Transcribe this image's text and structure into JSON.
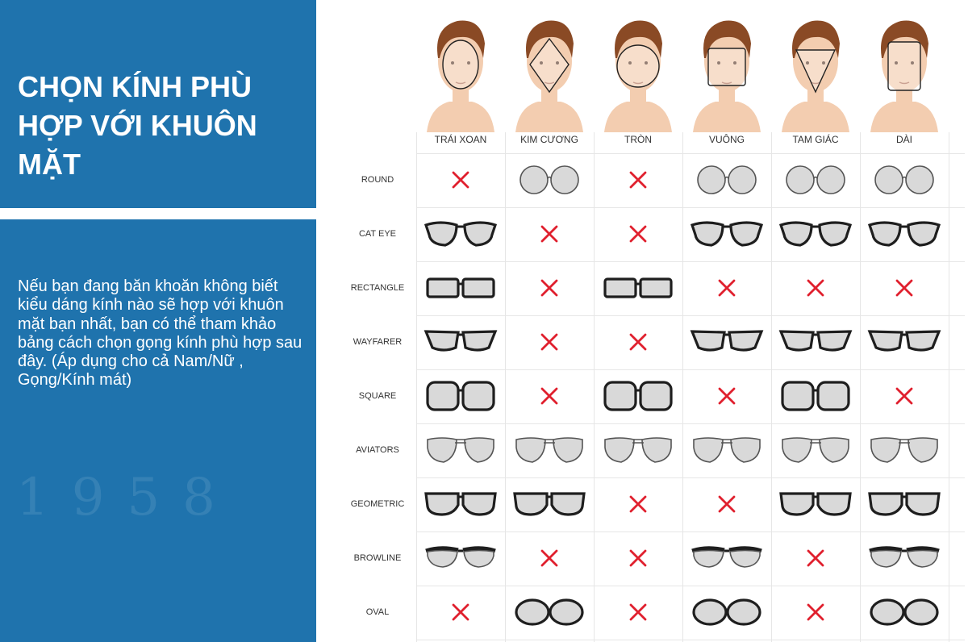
{
  "left_panel": {
    "title": "CHỌN KÍNH PHÙ HỢP VỚI KHUÔN MẶT",
    "description": "Nếu bạn đang băn khoăn không biết kiểu dáng kính nào sẽ hợp với khuôn mặt bạn nhất, bạn có thể tham khảo bảng cách chọn gọng kính phù hợp sau đây. (Áp dụng cho cả Nam/Nữ , Gọng/Kính mát)",
    "watermark": "1958",
    "background_color": "#1f73ad"
  },
  "table": {
    "columns": [
      "TRÁI XOAN",
      "KIM CƯƠNG",
      "TRÒN",
      "VUÔNG",
      "TAM GIÁC",
      "DÀI"
    ],
    "face_outlines": [
      "oval-outline",
      "diamond-outline",
      "circle-outline",
      "square-outline",
      "triangle-outline",
      "oblong-outline"
    ],
    "rows": [
      {
        "label": "ROUND",
        "shape": "round",
        "fits": [
          false,
          true,
          false,
          true,
          true,
          true
        ]
      },
      {
        "label": "CAT EYE",
        "shape": "cateye",
        "fits": [
          true,
          false,
          false,
          true,
          true,
          true
        ]
      },
      {
        "label": "RECTANGLE",
        "shape": "rectangle",
        "fits": [
          true,
          false,
          true,
          false,
          false,
          false
        ]
      },
      {
        "label": "WAYFARER",
        "shape": "wayfarer",
        "fits": [
          true,
          false,
          false,
          true,
          true,
          true
        ]
      },
      {
        "label": "SQUARE",
        "shape": "square",
        "fits": [
          true,
          false,
          true,
          false,
          true,
          false
        ]
      },
      {
        "label": "AVIATORS",
        "shape": "aviator",
        "fits": [
          true,
          true,
          true,
          true,
          true,
          true
        ]
      },
      {
        "label": "GEOMETRIC",
        "shape": "geometric",
        "fits": [
          true,
          true,
          false,
          false,
          true,
          true
        ]
      },
      {
        "label": "BROWLINE",
        "shape": "browline",
        "fits": [
          true,
          false,
          false,
          true,
          false,
          true
        ]
      },
      {
        "label": "OVAL",
        "shape": "oval",
        "fits": [
          false,
          true,
          false,
          true,
          false,
          true
        ]
      }
    ],
    "colors": {
      "cross": "#e0202e",
      "frame": "#1e1e1e",
      "thin_frame": "#555555",
      "lens": "#d9d9d9",
      "skin": "#f3cdb0",
      "hair": "#8a4a25"
    }
  }
}
